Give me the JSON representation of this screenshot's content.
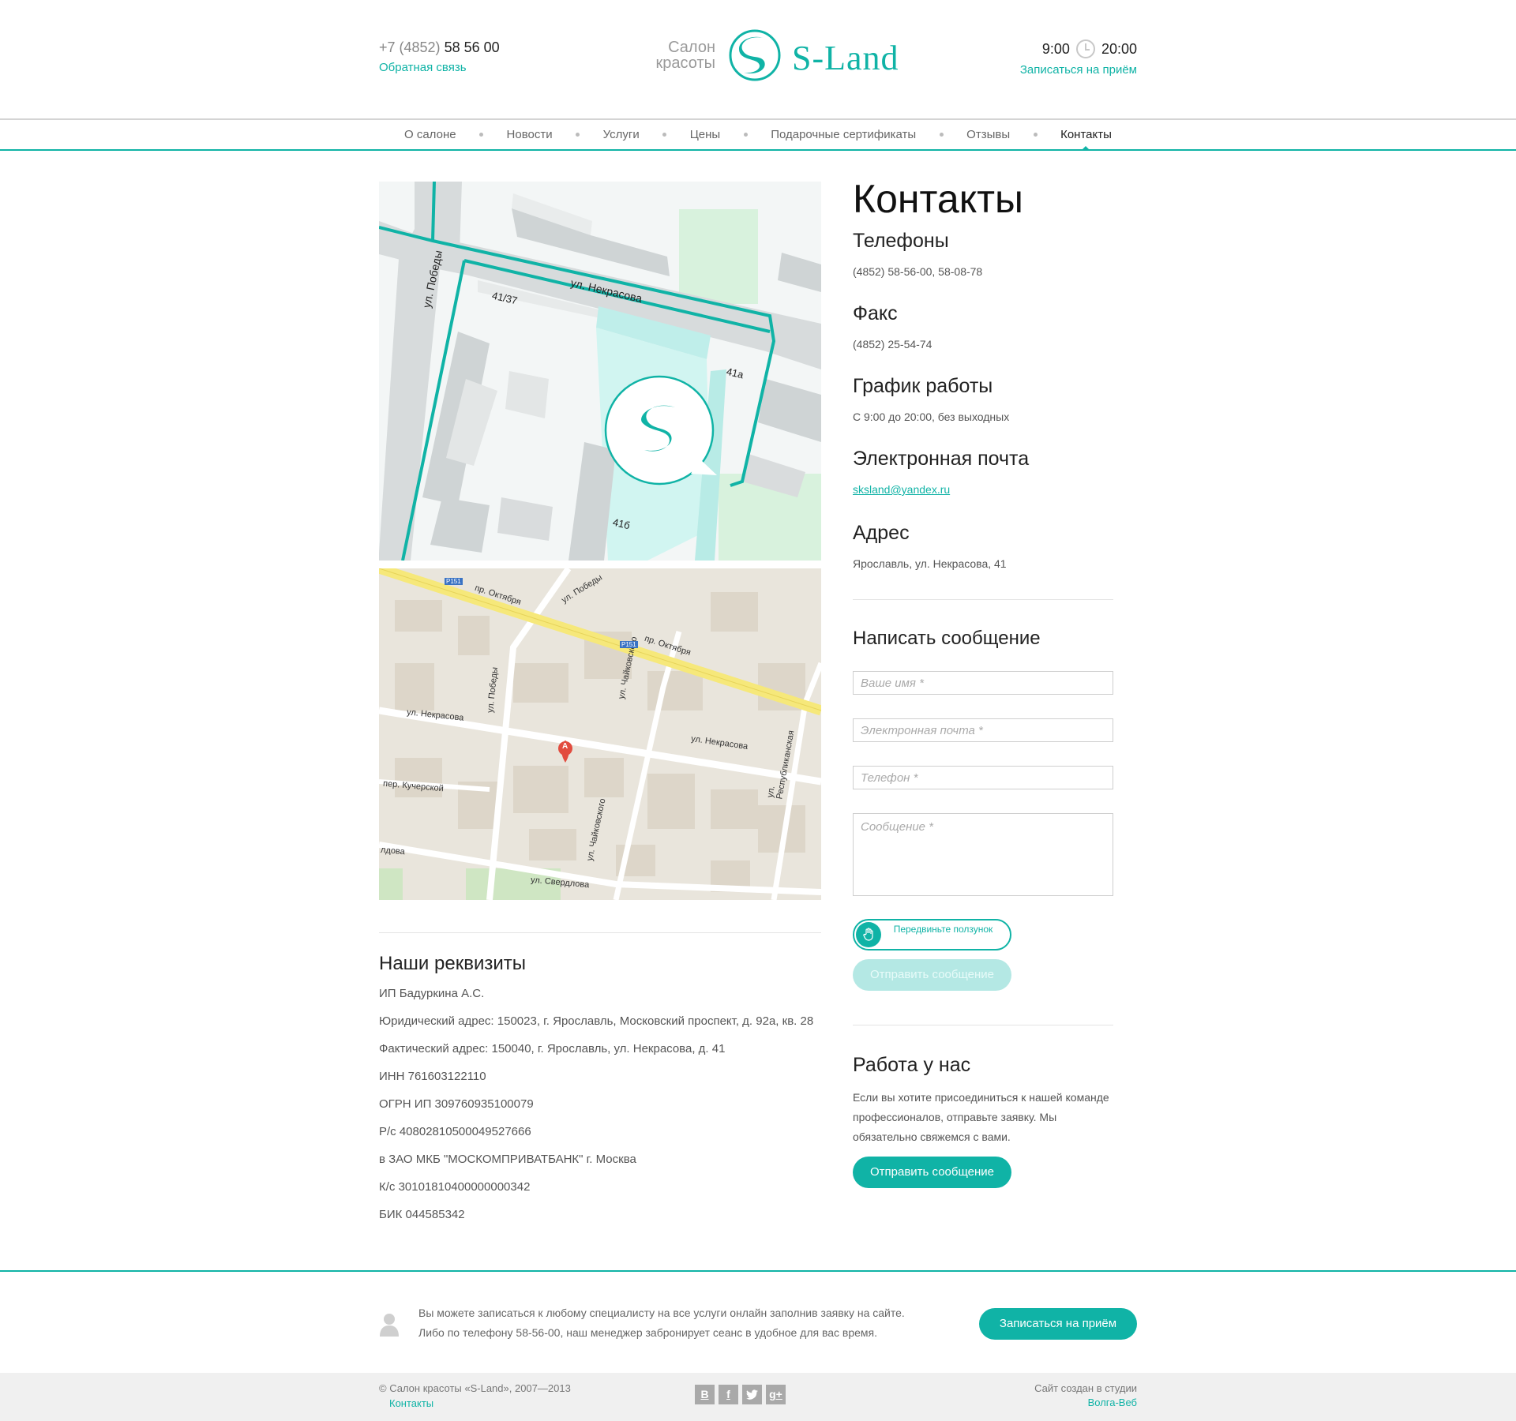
{
  "header": {
    "phone_prefix": "+7 (4852)",
    "phone_number": "58 56 00",
    "feedback_link": "Обратная связь",
    "logo_sub_1": "Салон",
    "logo_sub_2": "красоты",
    "logo_name": "S-Land",
    "hours_open": "9:00",
    "hours_close": "20:00",
    "booking_link": "Записаться на приём"
  },
  "nav": {
    "items": [
      {
        "label": "О салоне"
      },
      {
        "label": "Новости"
      },
      {
        "label": "Услуги"
      },
      {
        "label": "Цены"
      },
      {
        "label": "Подарочные сертификаты"
      },
      {
        "label": "Отзывы"
      },
      {
        "label": "Контакты"
      }
    ],
    "active": "Контакты"
  },
  "map_schematic": {
    "street_1": "ул. Некрасова",
    "street_2": "ул. Победы",
    "bldg_1": "41/37",
    "bldg_2": "41а",
    "bldg_3": "41б"
  },
  "map_city": {
    "labels": [
      "пр. Октября",
      "ул. Победы",
      "ул. Некрасова",
      "ул. Чайковского",
      "ул. Республиканская",
      "пер. Кучерской",
      "ул. Свердлова",
      "лдова",
      "P151",
      "A"
    ]
  },
  "contacts": {
    "title": "Контакты",
    "phones_h": "Телефоны",
    "phones": "(4852) 58-56-00, 58-08-78",
    "fax_h": "Факс",
    "fax": "(4852) 25-54-74",
    "schedule_h": "График работы",
    "schedule": "С 9:00 до 20:00, без выходных",
    "email_h": "Электронная почта",
    "email": "sksland@yandex.ru",
    "address_h": "Адрес",
    "address": "Ярославль, ул. Некрасова, 41"
  },
  "form": {
    "title": "Написать сообщение",
    "name_placeholder": "Ваше имя *",
    "email_placeholder": "Электронная почта *",
    "phone_placeholder": "Телефон *",
    "message_placeholder": "Сообщение *",
    "slider_label": "Передвиньте ползунок",
    "submit_label": "Отправить сообщение"
  },
  "requisites": {
    "title": "Наши реквизиты",
    "lines": [
      "ИП Бадуркина А.С.",
      "Юридический адрес: 150023, г. Ярославль, Московский проспект, д. 92а, кв. 28",
      "Фактический адрес: 150040, г. Ярославль, ул. Некрасова, д. 41",
      "ИНН 761603122110",
      "ОГРН ИП 309760935100079",
      "Р/с 40802810500049527666",
      "в ЗАО МКБ \"МОСКОМПРИВАТБАНК\" г. Москва",
      "К/с 30101810400000000342",
      "БИК 044585342"
    ]
  },
  "work": {
    "title": "Работа у нас",
    "text": "Если вы хотите присоединиться к нашей команде профессионалов, отправьте заявку. Мы обязательно свяжемся с вами.",
    "button": "Отправить сообщение"
  },
  "cta": {
    "line1": "Вы можете записаться к любому специалисту на все услуги онлайн заполнив заявку на сайте.",
    "line2": "Либо по телефону 58-56-00, наш менеджер забронирует сеанс в удобное для вас время.",
    "button": "Записаться на приём"
  },
  "footer": {
    "copyright": "© Салон красоты «S-Land», 2007—2013",
    "contacts_link": "Контакты",
    "social_vk": "В",
    "social_fb": "f",
    "social_gplus": "g+",
    "credit_line": "Сайт создан в студии",
    "credit_link": "Волга-Веб"
  },
  "colors": {
    "accent": "#10b3a6",
    "accent_light": "#b4e8e4",
    "map_road_yellow": "#f6e87a",
    "map_bg": "#e9e5dc"
  }
}
